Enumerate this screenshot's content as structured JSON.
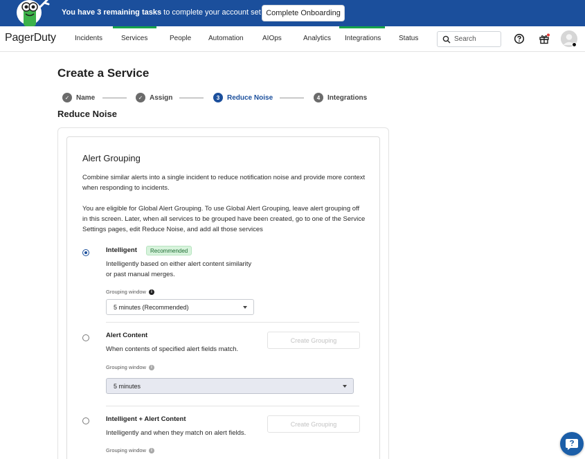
{
  "banner": {
    "message_bold": "You have 3 remaining tasks",
    "message_rest": " to complete your account set up",
    "cta_label": "Complete Onboarding"
  },
  "nav": {
    "logo": "PagerDuty",
    "items": [
      {
        "label": "Incidents"
      },
      {
        "label": "Services"
      },
      {
        "label": "People"
      },
      {
        "label": "Automation"
      },
      {
        "label": "AIOps"
      },
      {
        "label": "Analytics"
      },
      {
        "label": "Integrations"
      },
      {
        "label": "Status"
      }
    ],
    "search_placeholder": "Search",
    "accent_color": "#16a34a"
  },
  "page": {
    "title": "Create a Service",
    "section_title": "Reduce Noise",
    "steps": [
      {
        "number": "✓",
        "label": "Name",
        "state": "done"
      },
      {
        "number": "✓",
        "label": "Assign",
        "state": "done"
      },
      {
        "number": "3",
        "label": "Reduce Noise",
        "state": "active"
      },
      {
        "number": "4",
        "label": "Integrations",
        "state": "todo"
      }
    ]
  },
  "alert_grouping": {
    "title": "Alert Grouping",
    "intro": "Combine similar alerts into a single incident to reduce notification noise and provide more context when responding to incidents.",
    "eligibility": "You are eligible for Global Alert Grouping. To use Global Alert Grouping, leave alert grouping off in this screen. Later, when all services to be grouped have been created, go to one of the Service Settings pages, edit Reduce Noise, and add all those services",
    "options": [
      {
        "title": "Intelligent",
        "badge": "Recommended",
        "description": "Intelligently based on either alert content similarity or past manual merges.",
        "window_label": "Grouping window",
        "window_value": "5 minutes (Recommended)",
        "selected": true
      },
      {
        "title": "Alert Content",
        "description": "When contents of specified alert fields match.",
        "button": "Create Grouping",
        "window_label": "Grouping window",
        "window_value": "5 minutes",
        "selected": false
      },
      {
        "title": "Intelligent + Alert Content",
        "description": "Intelligently and when they match on alert fields.",
        "button": "Create Grouping",
        "window_label": "Grouping window",
        "selected": false
      }
    ]
  },
  "colors": {
    "banner": "#1b4f9c",
    "primary": "#1b4f9c",
    "badge_bg": "#d7f3dc"
  },
  "icons": {
    "search": "search-icon",
    "help": "question-circle-icon",
    "gift": "gift-icon",
    "chat_help": "help-chat-icon"
  }
}
